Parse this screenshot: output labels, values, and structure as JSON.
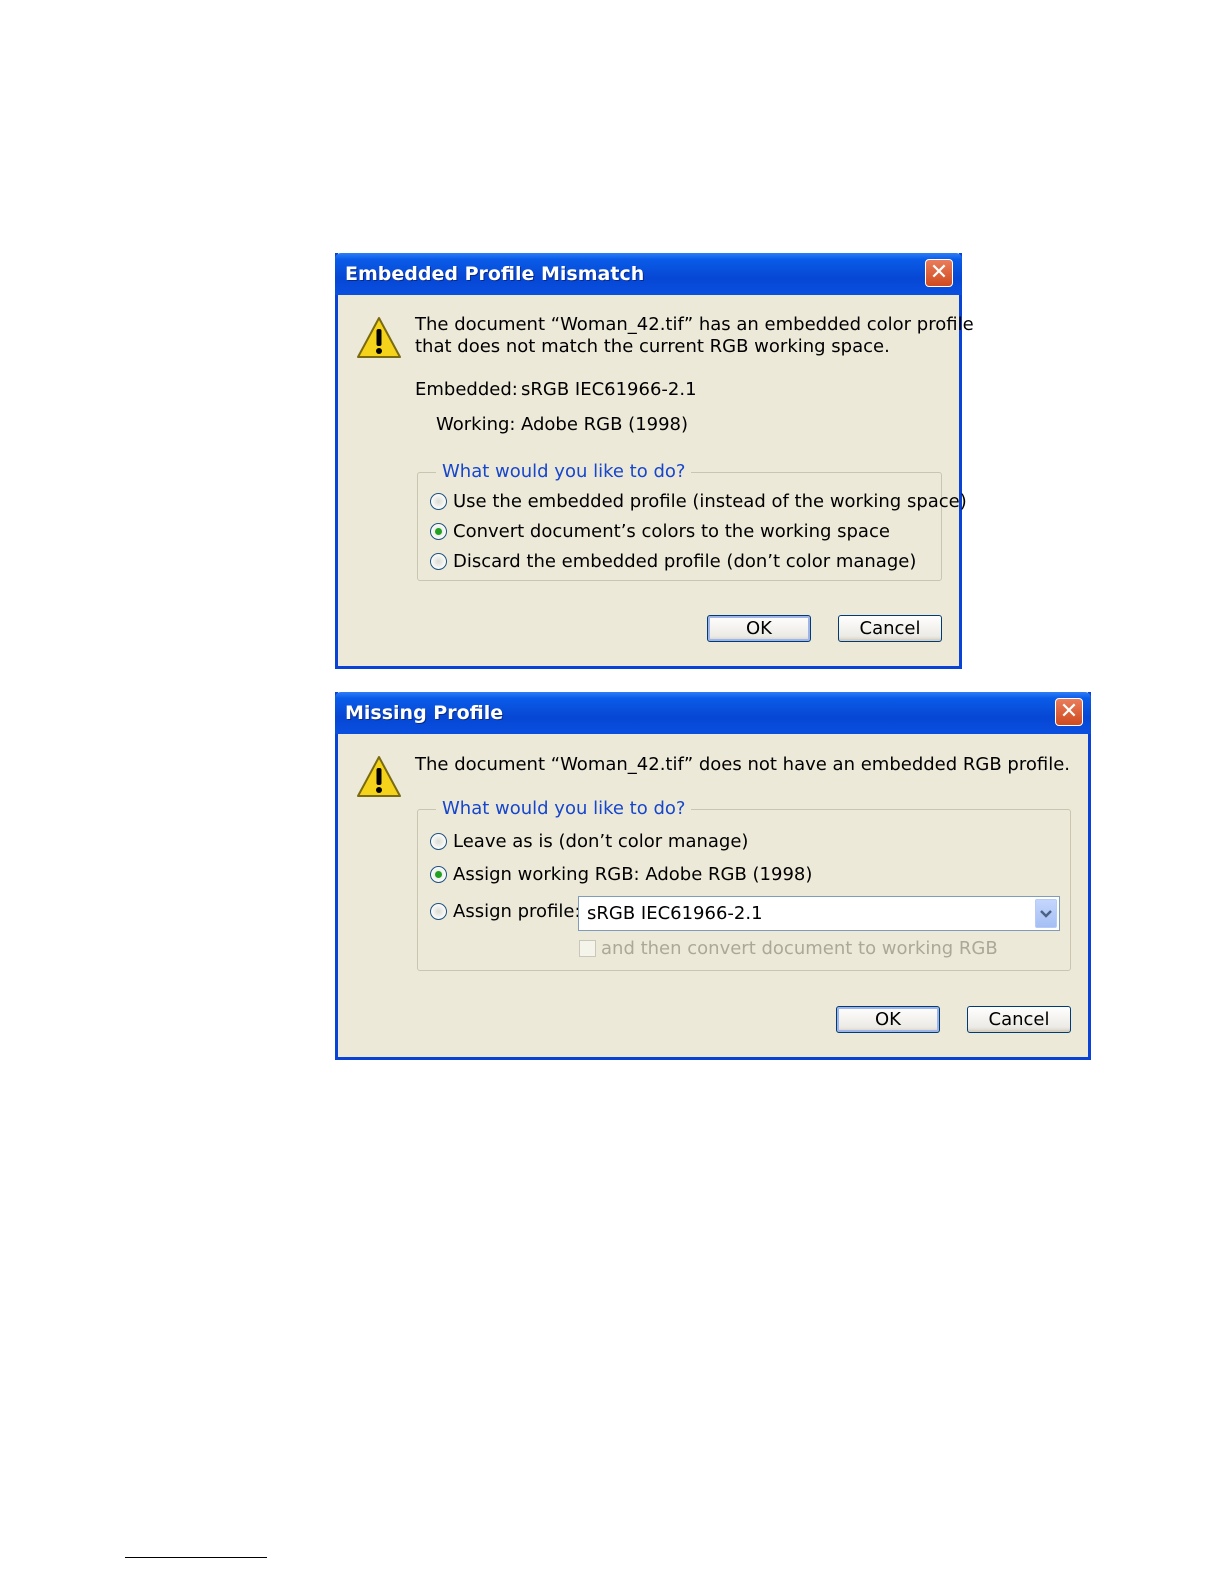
{
  "dialog1": {
    "title": "Embedded Profile Mismatch",
    "close_label": "✕",
    "message_line1": "The document “Woman_42.tif” has an embedded color profile",
    "message_line2": "that does not match the current RGB working space.",
    "embedded_label": "Embedded:",
    "embedded_value": "sRGB IEC61966-2.1",
    "working_label": "Working:",
    "working_value": "Adobe RGB (1998)",
    "group_title": "What would you like to do?",
    "options": [
      {
        "label": "Use the embedded profile (instead of the working space)",
        "checked": false
      },
      {
        "label": "Convert document’s colors to the working space",
        "checked": true
      },
      {
        "label": "Discard the embedded profile (don’t color manage)",
        "checked": false
      }
    ],
    "ok_label": "OK",
    "cancel_label": "Cancel"
  },
  "dialog2": {
    "title": "Missing Profile",
    "close_label": "✕",
    "message": "The document “Woman_42.tif” does not have an embedded RGB profile.",
    "group_title": "What would you like to do?",
    "options": [
      {
        "label": "Leave as is (don’t color manage)",
        "checked": false
      },
      {
        "label": "Assign working RGB:  Adobe RGB (1998)",
        "checked": true
      },
      {
        "label": "Assign profile:",
        "checked": false
      }
    ],
    "profile_select_value": "sRGB IEC61966-2.1",
    "convert_checkbox_label": "and then convert document to working RGB",
    "convert_checkbox_checked": false,
    "ok_label": "OK",
    "cancel_label": "Cancel"
  },
  "colors": {
    "titlebar": "#0a5ce8",
    "dialog_bg": "#ece9d8",
    "group_title": "#1646cc",
    "radio_dot": "#21a121",
    "close_button": "#d04a1f"
  }
}
